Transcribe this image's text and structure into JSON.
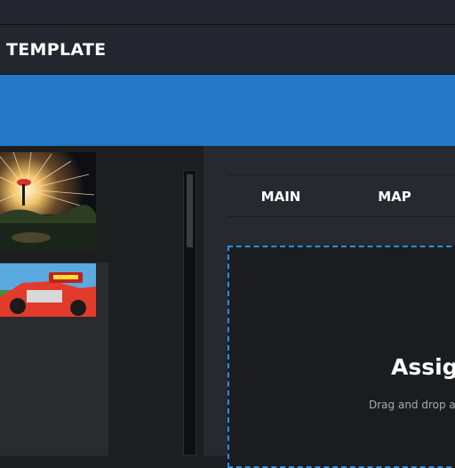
{
  "header": {
    "title": "TEMPLATE"
  },
  "banner": {
    "color": "#2478c5"
  },
  "tabs": [
    {
      "label": "MAIN"
    },
    {
      "label": "MAP"
    }
  ],
  "dropzone": {
    "title": "Assign",
    "hint": "Drag and drop a flo",
    "border_color": "#2a8ee0"
  },
  "thumbnails": [
    {
      "subject": "sparkler-light-painting-photo"
    },
    {
      "subject": "race-car-photo"
    }
  ]
}
